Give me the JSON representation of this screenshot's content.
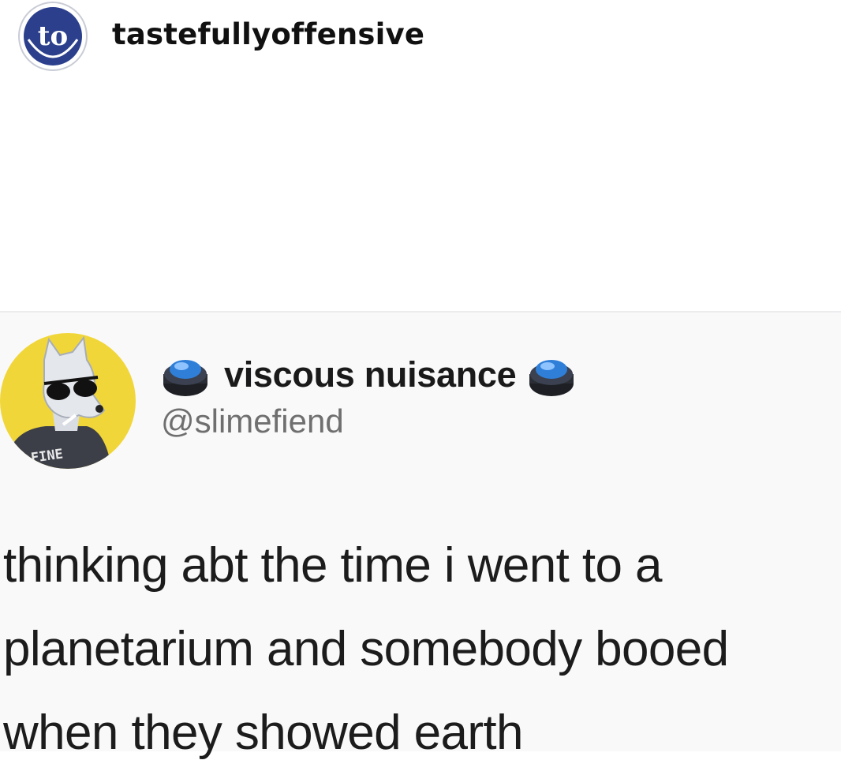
{
  "post": {
    "account": {
      "username": "tastefullyoffensive",
      "avatar_text": "to",
      "avatar_color": "#2b3f8c"
    }
  },
  "tweet": {
    "display_name": "viscous nuisance",
    "handle": "@slimefiend",
    "avatar_shirt_text": "FINE",
    "avatar_bg_color": "#f1d63a",
    "name_icons": [
      "blue-button-icon",
      "blue-button-icon"
    ],
    "text_lines": [
      "thinking abt the time i went to a",
      "planetarium and somebody booed",
      "when they showed earth"
    ]
  }
}
